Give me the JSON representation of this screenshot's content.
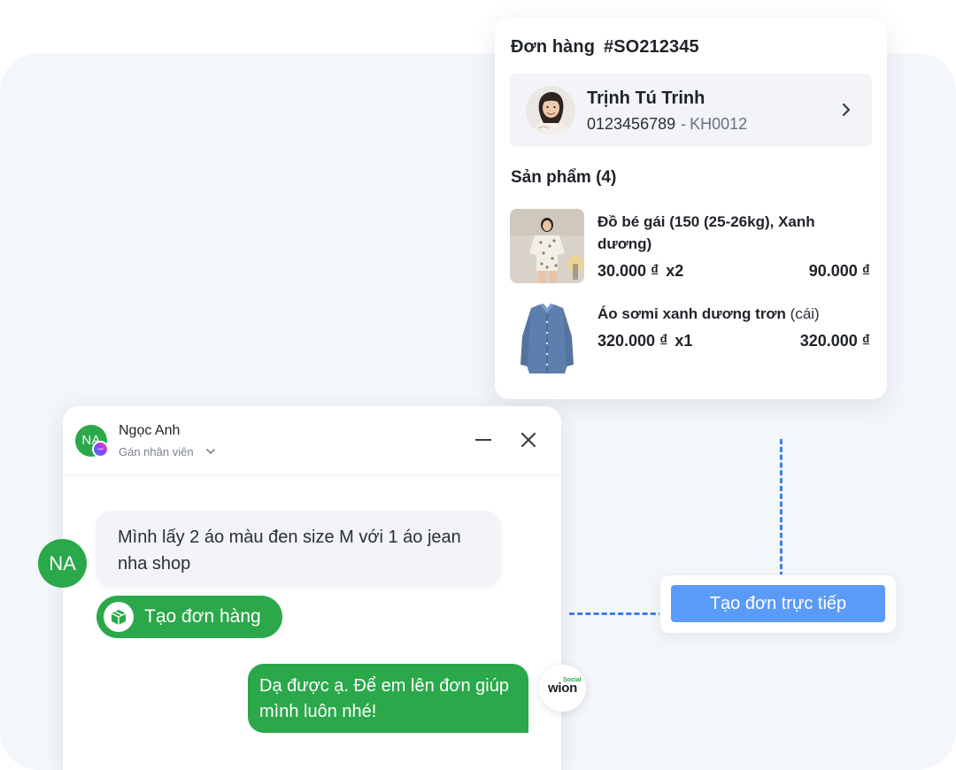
{
  "order": {
    "title_prefix": "Đơn hàng",
    "code": "#SO212345",
    "customer": {
      "name": "Trịnh Tú Trinh",
      "phone": "0123456789",
      "separator": "-",
      "customer_id": "KH0012"
    },
    "products_title": "Sản phẩm (4)",
    "products": [
      {
        "name": "Đồ bé gái (150 (25-26kg), Xanh dương)",
        "unit": "",
        "price": "30.000 ₫",
        "qty": "x2",
        "total": "90.000 ₫"
      },
      {
        "name": "Áo sơmi xanh dương trơn",
        "unit": "(cái)",
        "price": "320.000 ₫",
        "qty": "x1",
        "total": "320.000 ₫"
      }
    ]
  },
  "direct_order_button": "Tạo đơn trực tiếp",
  "chat": {
    "contact_name": "Ngọc Anh",
    "contact_initials": "NA",
    "assign_label": "Gán nhân viên",
    "incoming_message": "Mình lấy 2 áo màu đen size M với 1 áo jean nha shop",
    "create_order_button": "Tạo đơn hàng",
    "outgoing_message": "Dạ được ạ. Để em lên đơn giúp mình luôn nhé!",
    "brand_word": "wion",
    "brand_tag": "Social"
  },
  "colors": {
    "green": "#2aa84a",
    "blue": "#5b9bf8",
    "dash_blue": "#3b7ee8",
    "backdrop": "#f3f6fa"
  }
}
